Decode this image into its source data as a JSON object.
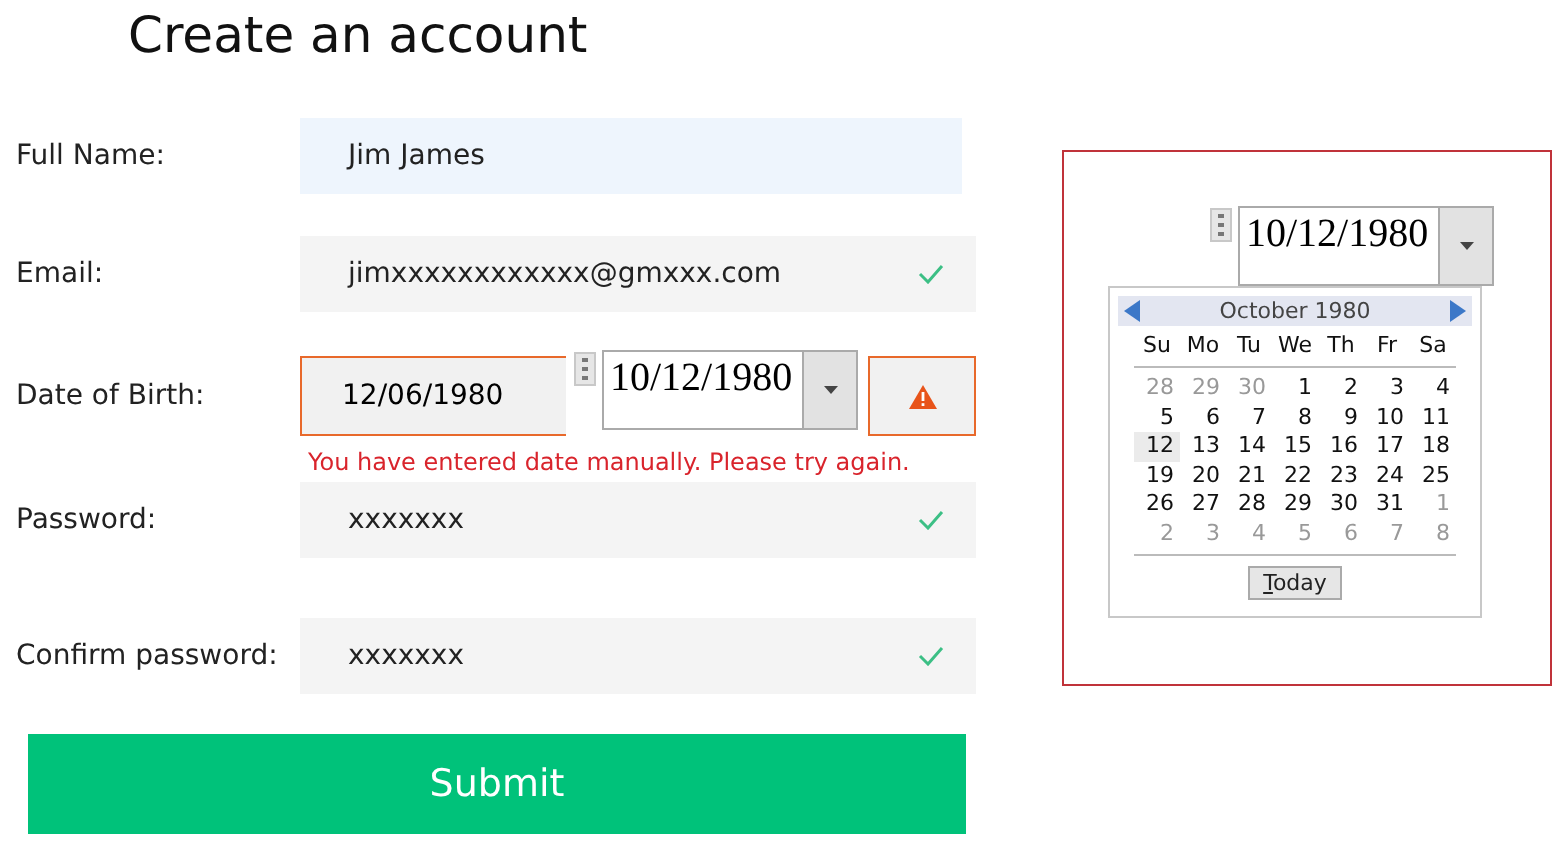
{
  "title": "Create an account",
  "fields": [
    {
      "label": "Full Name:",
      "value": "Jim James",
      "kind": "text",
      "focused": true,
      "valid": false
    },
    {
      "label": "Email:",
      "value": "jimxxxxxxxxxxxx@gmxxx.com",
      "kind": "text",
      "focused": false,
      "valid": true
    },
    {
      "label": "Date of Birth:",
      "value": "12/06/1980",
      "kind": "date",
      "focused": false,
      "valid": false,
      "error": "You have entered date manually. Please try again.",
      "picker_value": "10/12/1980"
    },
    {
      "label": "Password:",
      "value": "xxxxxxx",
      "kind": "text",
      "focused": false,
      "valid": true
    },
    {
      "label": "Confirm password:",
      "value": "xxxxxxx",
      "kind": "text",
      "focused": false,
      "valid": true
    }
  ],
  "submit": "Submit",
  "calendar_demo": {
    "value": "10/12/1980",
    "month": "October 1980",
    "weekdays": [
      "Su",
      "Mo",
      "Tu",
      "We",
      "Th",
      "Fr",
      "Sa"
    ],
    "today_button": "Today",
    "days": [
      {
        "day": "28",
        "in_month": false,
        "selected": false
      },
      {
        "day": "29",
        "in_month": false,
        "selected": false
      },
      {
        "day": "30",
        "in_month": false,
        "selected": false
      },
      {
        "day": "1",
        "in_month": true,
        "selected": false
      },
      {
        "day": "2",
        "in_month": true,
        "selected": false
      },
      {
        "day": "3",
        "in_month": true,
        "selected": false
      },
      {
        "day": "4",
        "in_month": true,
        "selected": false
      },
      {
        "day": "5",
        "in_month": true,
        "selected": false
      },
      {
        "day": "6",
        "in_month": true,
        "selected": false
      },
      {
        "day": "7",
        "in_month": true,
        "selected": false
      },
      {
        "day": "8",
        "in_month": true,
        "selected": false
      },
      {
        "day": "9",
        "in_month": true,
        "selected": false
      },
      {
        "day": "10",
        "in_month": true,
        "selected": false
      },
      {
        "day": "11",
        "in_month": true,
        "selected": false
      },
      {
        "day": "12",
        "in_month": true,
        "selected": true
      },
      {
        "day": "13",
        "in_month": true,
        "selected": false
      },
      {
        "day": "14",
        "in_month": true,
        "selected": false
      },
      {
        "day": "15",
        "in_month": true,
        "selected": false
      },
      {
        "day": "16",
        "in_month": true,
        "selected": false
      },
      {
        "day": "17",
        "in_month": true,
        "selected": false
      },
      {
        "day": "18",
        "in_month": true,
        "selected": false
      },
      {
        "day": "19",
        "in_month": true,
        "selected": false
      },
      {
        "day": "20",
        "in_month": true,
        "selected": false
      },
      {
        "day": "21",
        "in_month": true,
        "selected": false
      },
      {
        "day": "22",
        "in_month": true,
        "selected": false
      },
      {
        "day": "23",
        "in_month": true,
        "selected": false
      },
      {
        "day": "24",
        "in_month": true,
        "selected": false
      },
      {
        "day": "25",
        "in_month": true,
        "selected": false
      },
      {
        "day": "26",
        "in_month": true,
        "selected": false
      },
      {
        "day": "27",
        "in_month": true,
        "selected": false
      },
      {
        "day": "28",
        "in_month": true,
        "selected": false
      },
      {
        "day": "29",
        "in_month": true,
        "selected": false
      },
      {
        "day": "30",
        "in_month": true,
        "selected": false
      },
      {
        "day": "31",
        "in_month": true,
        "selected": false
      },
      {
        "day": "1",
        "in_month": false,
        "selected": false
      },
      {
        "day": "2",
        "in_month": false,
        "selected": false
      },
      {
        "day": "3",
        "in_month": false,
        "selected": false
      },
      {
        "day": "4",
        "in_month": false,
        "selected": false
      },
      {
        "day": "5",
        "in_month": false,
        "selected": false
      },
      {
        "day": "6",
        "in_month": false,
        "selected": false
      },
      {
        "day": "7",
        "in_month": false,
        "selected": false
      },
      {
        "day": "8",
        "in_month": false,
        "selected": false
      }
    ]
  }
}
